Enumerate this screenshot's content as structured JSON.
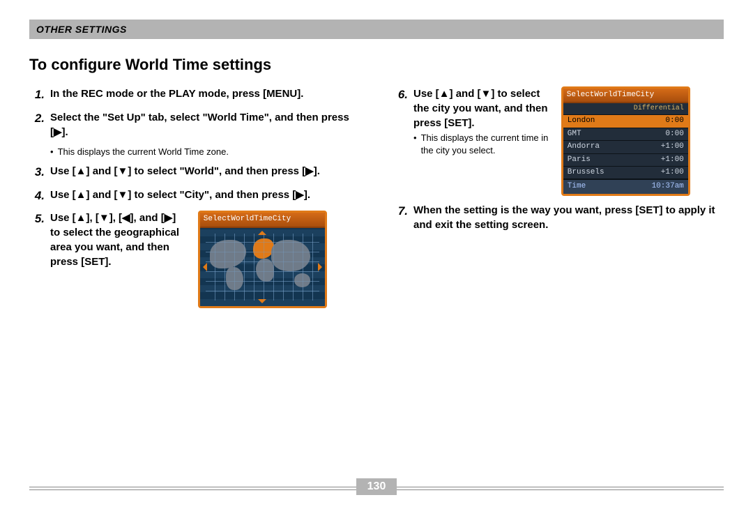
{
  "header": "OTHER SETTINGS",
  "title": "To configure World Time settings",
  "steps": {
    "s1": "In the REC mode or the PLAY mode, press [MENU].",
    "s2": "Select the \"Set Up\" tab, select \"World Time\", and then press [▶].",
    "s2_note": "This displays the current World Time zone.",
    "s3": "Use [▲] and [▼] to select \"World\", and then press [▶].",
    "s4": "Use [▲] and [▼] to select \"City\", and then press [▶].",
    "s5": "Use [▲], [▼], [◀], and [▶] to select the geographical area you want, and then press [SET].",
    "s6": "Use [▲] and [▼] to select the city you want, and then press [SET].",
    "s6_note": "This displays the current time in the city you select.",
    "s7": "When the setting is the way you want, press [SET] to apply it and exit the setting screen."
  },
  "nums": {
    "n1": "1.",
    "n2": "2.",
    "n3": "3.",
    "n4": "4.",
    "n5": "5.",
    "n6": "6.",
    "n7": "7."
  },
  "lcd": {
    "title": "SelectWorldTimeCity",
    "diff_label": "Differential",
    "rows": [
      {
        "city": "London",
        "diff": "0:00"
      },
      {
        "city": "GMT",
        "diff": "0:00"
      },
      {
        "city": "Andorra",
        "diff": "+1:00"
      },
      {
        "city": "Paris",
        "diff": "+1:00"
      },
      {
        "city": "Brussels",
        "diff": "+1:00"
      }
    ],
    "time_label": "Time",
    "time_value": "10:37am"
  },
  "page_number": "130"
}
